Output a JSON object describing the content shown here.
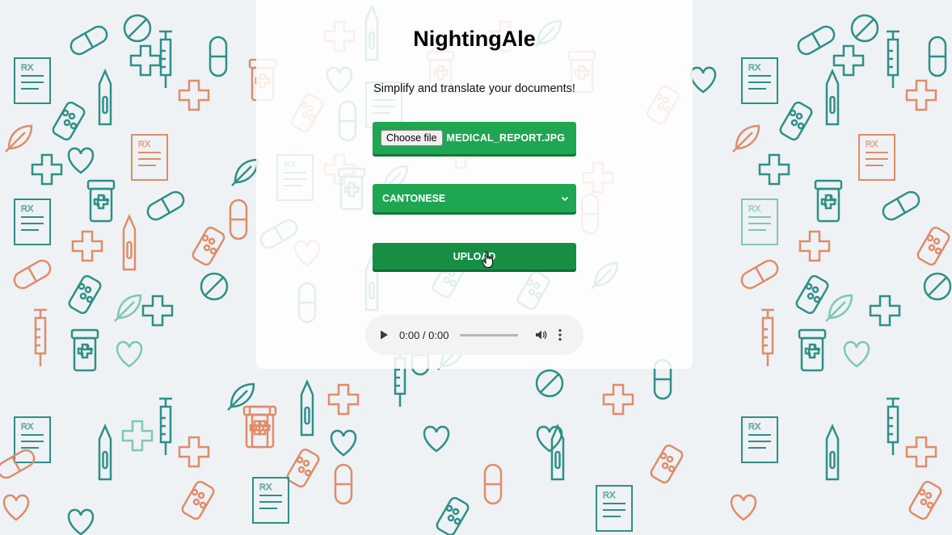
{
  "app": {
    "title": "NightingAle",
    "subtitle": "Simplify and translate your documents!"
  },
  "file_input": {
    "button_label": "Choose file",
    "file_name": "MEDICAL_REPORT.JPG"
  },
  "language_select": {
    "selected": "CANTONESE",
    "icon": "chevron-down-icon"
  },
  "upload": {
    "label": "UPLOAD"
  },
  "audio_player": {
    "time": "0:00 / 0:00",
    "progress": 0,
    "icons": [
      "play-icon",
      "volume-icon",
      "more-options-icon"
    ]
  },
  "colors": {
    "button_green": "#1fa652",
    "upload_green": "#168f45",
    "pattern_teal": "#2e8f88",
    "pattern_orange": "#e08c6a",
    "background": "#eef2f5"
  }
}
